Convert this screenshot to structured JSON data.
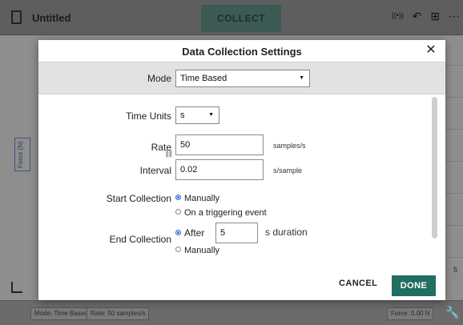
{
  "app": {
    "title": "Untitled",
    "collect_label": "COLLECT",
    "axis_label": "Force (N)",
    "right_label": "5",
    "status": {
      "mode": "Mode: Time Based",
      "rate": "Rate: 50 samples/s",
      "force": "Force: 0.00 N"
    }
  },
  "dialog": {
    "title": "Data Collection Settings",
    "close_glyph": "✕",
    "mode_label": "Mode",
    "mode_value": "Time Based",
    "time_units_label": "Time Units",
    "time_units_value": "s",
    "rate_label": "Rate",
    "rate_value": "50",
    "rate_unit": "samples/s",
    "interval_label": "Interval",
    "interval_value": "0.02",
    "interval_unit": "s/sample",
    "start_label": "Start Collection",
    "start_options": [
      "Manually",
      "On a triggering event"
    ],
    "start_selected": "Manually",
    "end_label": "End Collection",
    "end_after_label": "After",
    "end_after_value": "5",
    "end_after_unit": "s duration",
    "end_options": [
      "After",
      "Manually"
    ],
    "end_selected": "After",
    "cancel_label": "CANCEL",
    "done_label": "DONE"
  },
  "colors": {
    "accent": "#216e63",
    "radio_selected": "#2a6dd6"
  }
}
